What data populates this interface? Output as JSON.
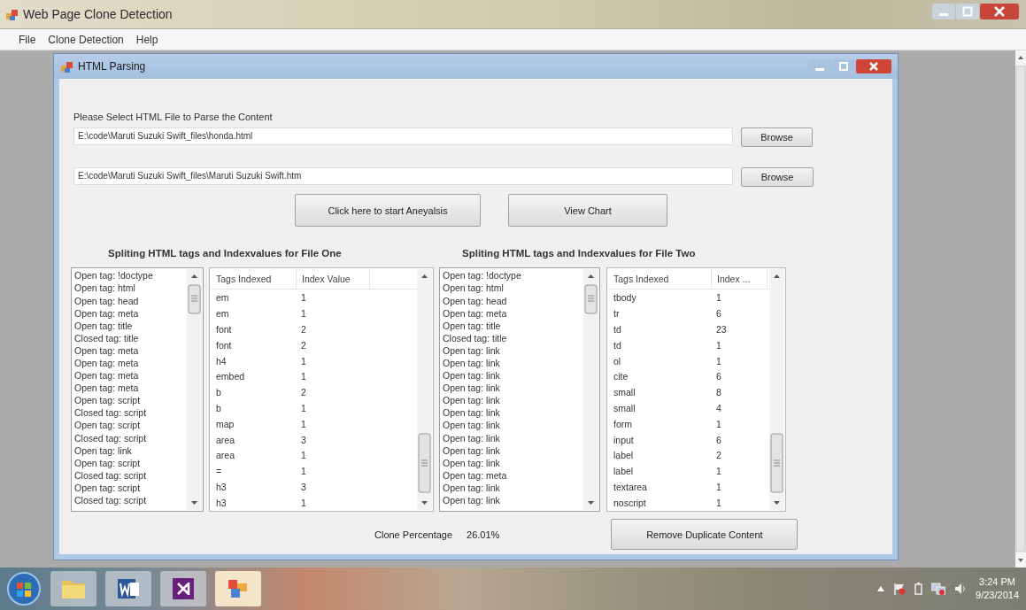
{
  "app_window": {
    "title": "Web Page Clone Detection"
  },
  "menu": [
    {
      "label": "File"
    },
    {
      "label": "Clone Detection"
    },
    {
      "label": "Help"
    }
  ],
  "child_window": {
    "title": "HTML Parsing",
    "select_label": "Please Select HTML File to Parse the Content",
    "files": [
      {
        "value": "E:\\code\\Maruti Suzuki Swift_files\\honda.html",
        "button": "Browse"
      },
      {
        "value": "E:\\code\\Maruti Suzuki Swift_files\\Maruti Suzuki Swift.htm",
        "button": "Browse"
      }
    ],
    "actions": [
      "Click here to start Aneyalsis",
      "View Chart"
    ],
    "panels": [
      {
        "heading": "Spliting HTML tags and Indexvalues for File One",
        "tag_list": [
          "Open tag: !doctype",
          "Open tag: html",
          "Open tag: head",
          "Open tag: meta",
          "Open tag: title",
          "Closed tag: title",
          "Open tag: meta",
          "Open tag: meta",
          "Open tag: meta",
          "Open tag: meta",
          "Open tag: script",
          "Closed tag: script",
          "Open tag: script",
          "Closed tag: script",
          "Open tag: link",
          "Open tag: script",
          "Closed tag: script",
          "Open tag: script",
          "Closed tag: script"
        ],
        "table": {
          "columns": [
            "Tags Indexed",
            "Index Value"
          ],
          "rows": [
            [
              "em",
              "1"
            ],
            [
              "em",
              "1"
            ],
            [
              "font",
              "2"
            ],
            [
              "font",
              "2"
            ],
            [
              "h4",
              "1"
            ],
            [
              "embed",
              "1"
            ],
            [
              "b",
              "2"
            ],
            [
              "b",
              "1"
            ],
            [
              "map",
              "1"
            ],
            [
              "area",
              "3"
            ],
            [
              "area",
              "1"
            ],
            [
              "=",
              "1"
            ],
            [
              "h3",
              "3"
            ],
            [
              "h3",
              "1"
            ]
          ]
        }
      },
      {
        "heading": "Spliting HTML tags and Indexvalues for File Two",
        "tag_list": [
          "Open tag: !doctype",
          "Open tag: html",
          "Open tag: head",
          "Open tag: meta",
          "Open tag: title",
          "Closed tag: title",
          "Open tag: link",
          "Open tag: link",
          "Open tag: link",
          "Open tag: link",
          "Open tag: link",
          "Open tag: link",
          "Open tag: link",
          "Open tag: link",
          "Open tag: link",
          "Open tag: link",
          "Open tag: meta",
          "Open tag: link",
          "Open tag: link"
        ],
        "table": {
          "columns": [
            "Tags Indexed",
            "Index ..."
          ],
          "rows": [
            [
              "tbody",
              "1"
            ],
            [
              "tr",
              "6"
            ],
            [
              "td",
              "23"
            ],
            [
              "td",
              "1"
            ],
            [
              "ol",
              "1"
            ],
            [
              "cite",
              "6"
            ],
            [
              "small",
              "8"
            ],
            [
              "small",
              "4"
            ],
            [
              "form",
              "1"
            ],
            [
              "input",
              "6"
            ],
            [
              "label",
              "2"
            ],
            [
              "label",
              "1"
            ],
            [
              "textarea",
              "1"
            ],
            [
              "noscript",
              "1"
            ]
          ]
        }
      }
    ],
    "clone_percentage": {
      "label": "Clone Percentage",
      "value": "26.01%"
    },
    "remove_button": "Remove Duplicate Content"
  },
  "clock": {
    "time": "3:24 PM",
    "date": "9/23/2014"
  }
}
